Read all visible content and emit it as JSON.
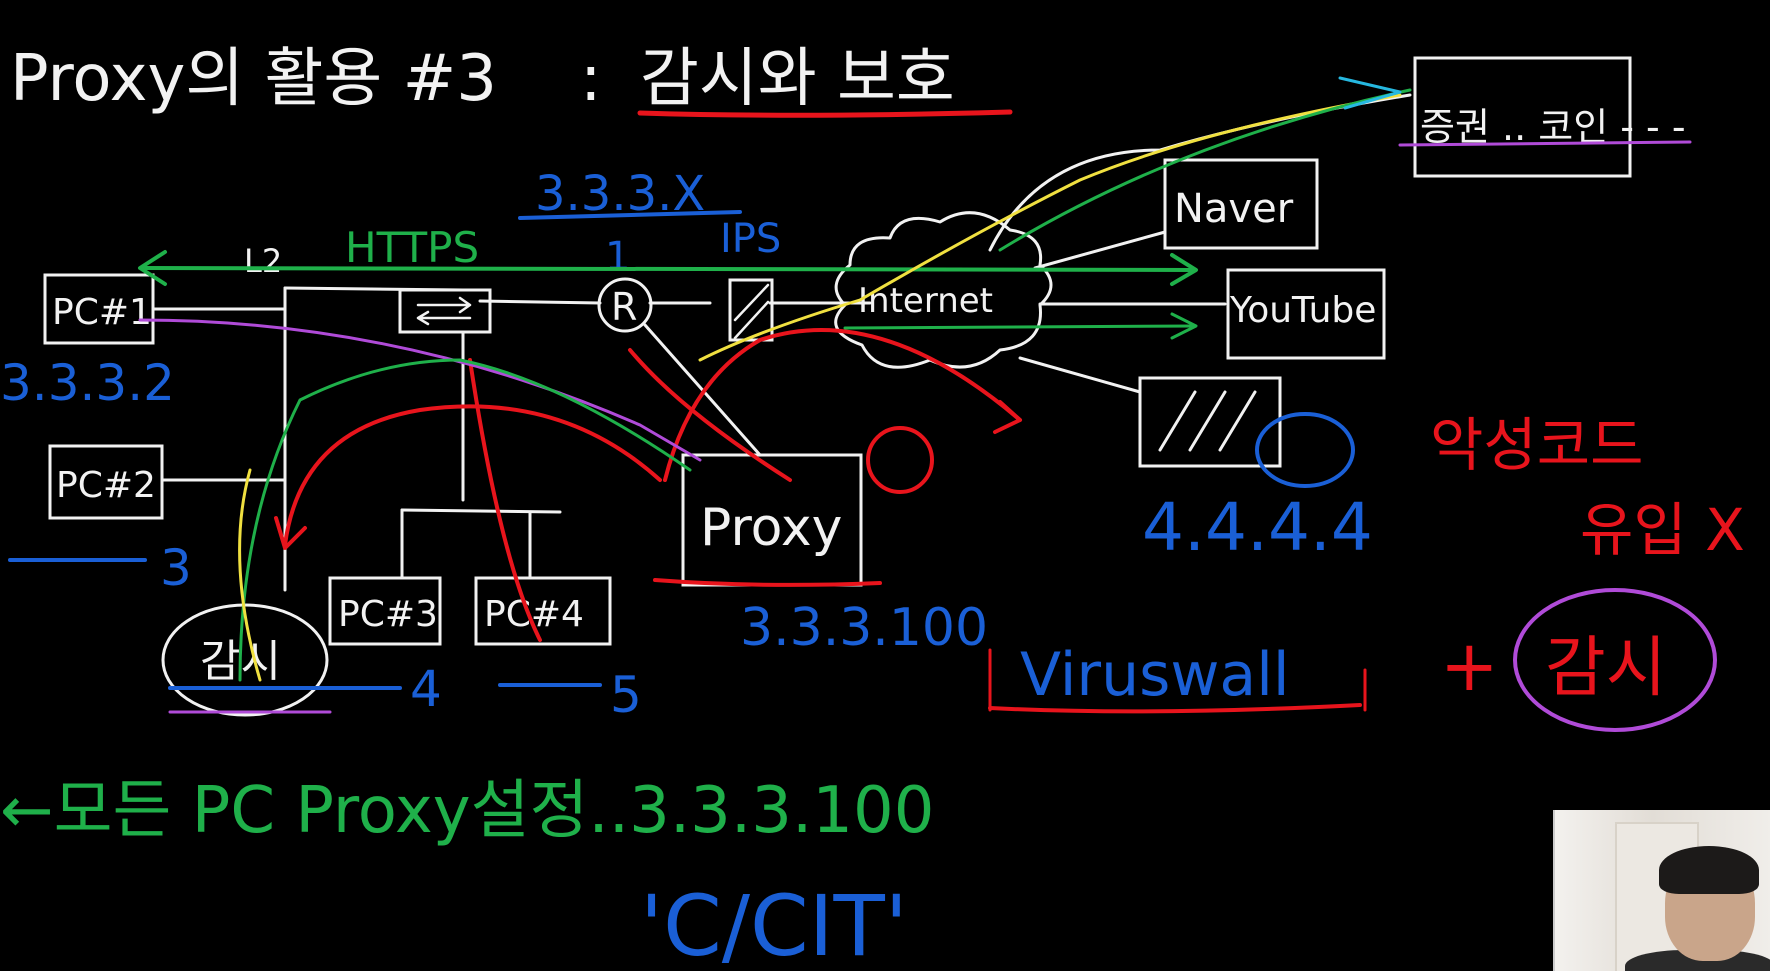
{
  "title": {
    "part1": "Proxy의 활용 #3",
    "colon": ":",
    "part2": "감시와 보호"
  },
  "nodes": {
    "pc1": "PC#1",
    "pc2": "PC#2",
    "pc3": "PC#3",
    "pc4": "PC#4",
    "switch_l2": "L2",
    "router": "R",
    "ips": "IPS",
    "internet": "Internet",
    "naver": "Naver",
    "youtube": "YouTube",
    "securities": "증권 .. 코인 - - -",
    "proxy": "Proxy",
    "attacker_ip": "4.4.4.4",
    "boss": "감시"
  },
  "labels": {
    "https": "HTTPS",
    "subnet": "3.3.3.X",
    "router_port": "1",
    "pc1_ip": "3.3.3.2",
    "pc2_ip": "3",
    "pc3_ip": "4",
    "pc4_ip": "5",
    "proxy_ip": "3.3.3.100",
    "viruswall": "Viruswall",
    "malware_line1": "악성코드",
    "malware_line2": "유입 X",
    "plus": "+",
    "note_all_pcs": "←모든 PC  Proxy설정..3.3.3.100",
    "note_cit": "'C/CIT'"
  },
  "colors": {
    "background": "#000000",
    "ink_white": "#f2f2f2",
    "ink_red": "#e8141c",
    "ink_blue": "#1a5fd6",
    "ink_green": "#1fb04a",
    "ink_purple": "#b04bd8",
    "ink_yellow": "#f0e040"
  }
}
